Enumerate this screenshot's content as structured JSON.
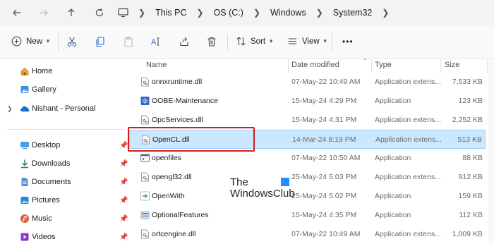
{
  "address": {
    "crumbs": [
      "This PC",
      "OS (C:)",
      "Windows",
      "System32"
    ]
  },
  "toolbar": {
    "new_label": "New",
    "sort_label": "Sort",
    "view_label": "View",
    "more_label": "•••"
  },
  "sidebar": {
    "top_items": [
      {
        "label": "Home",
        "icon": "home-icon"
      },
      {
        "label": "Gallery",
        "icon": "gallery-icon"
      },
      {
        "label": "Nishant - Personal",
        "icon": "onedrive-cloud-icon"
      }
    ],
    "quick_items": [
      {
        "label": "Desktop",
        "icon": "desktop-icon"
      },
      {
        "label": "Downloads",
        "icon": "downloads-icon"
      },
      {
        "label": "Documents",
        "icon": "documents-icon"
      },
      {
        "label": "Pictures",
        "icon": "pictures-icon"
      },
      {
        "label": "Music",
        "icon": "music-icon"
      },
      {
        "label": "Videos",
        "icon": "videos-icon"
      }
    ]
  },
  "columns": {
    "name": "Name",
    "date": "Date modified",
    "type": "Type",
    "size": "Size"
  },
  "files": [
    {
      "name": "onnxruntime.dll",
      "date": "07-May-22 10:49 AM",
      "type": "Application extens...",
      "size": "7,533 KB",
      "icon": "dll-icon"
    },
    {
      "name": "OOBE-Maintenance",
      "date": "15-May-24 4:29 PM",
      "type": "Application",
      "size": "123 KB",
      "icon": "gear-app-icon"
    },
    {
      "name": "OpcServices.dll",
      "date": "15-May-24 4:31 PM",
      "type": "Application extens...",
      "size": "2,252 KB",
      "icon": "dll-icon"
    },
    {
      "name": "OpenCL.dll",
      "date": "14-Mar-24 8:19 PM",
      "type": "Application extens...",
      "size": "513 KB",
      "icon": "dll-icon",
      "selected": true
    },
    {
      "name": "openfiles",
      "date": "07-May-22 10:50 AM",
      "type": "Application",
      "size": "88 KB",
      "icon": "console-app-icon"
    },
    {
      "name": "opengl32.dll",
      "date": "25-May-24 5:03 PM",
      "type": "Application extens...",
      "size": "912 KB",
      "icon": "dll-icon"
    },
    {
      "name": "OpenWith",
      "date": "25-May-24 5:02 PM",
      "type": "Application",
      "size": "159 KB",
      "icon": "openwith-app-icon"
    },
    {
      "name": "OptionalFeatures",
      "date": "15-May-24 4:35 PM",
      "type": "Application",
      "size": "112 KB",
      "icon": "features-app-icon"
    },
    {
      "name": "ortcengine.dll",
      "date": "07-May-22 10:49 AM",
      "type": "Application extens...",
      "size": "1,009 KB",
      "icon": "dll-icon"
    }
  ],
  "watermark": {
    "line1": "The",
    "line2": "WindowsClub"
  }
}
